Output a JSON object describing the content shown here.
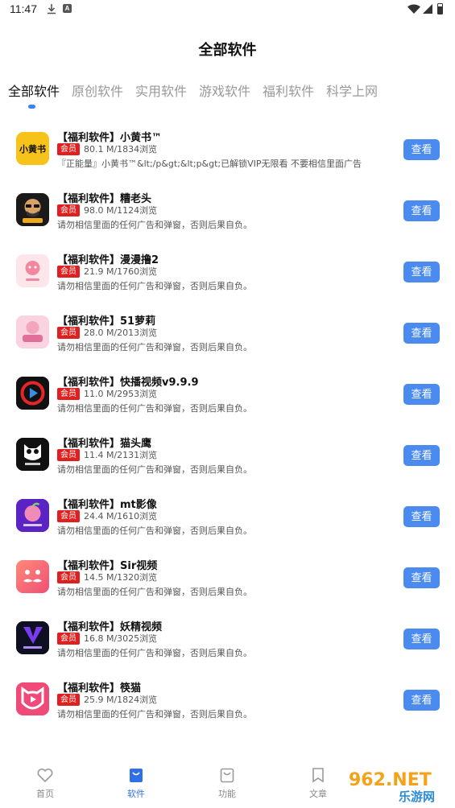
{
  "status_bar": {
    "time": "11:47",
    "a_label": "A"
  },
  "page": {
    "title": "全部软件"
  },
  "tabs": [
    {
      "label": "全部软件",
      "active": true
    },
    {
      "label": "原创软件",
      "active": false
    },
    {
      "label": "实用软件",
      "active": false
    },
    {
      "label": "游戏软件",
      "active": false
    },
    {
      "label": "福利软件",
      "active": false
    },
    {
      "label": "科学上网",
      "active": false
    }
  ],
  "items": [
    {
      "title": "【福利软件】小黄书™",
      "badge": "会员",
      "meta": "80.1 M/1834浏览",
      "desc": "『正能量』小黄书™&lt;/p&gt;&lt;p&gt;已解锁VIP无限看 不要相信里面广告",
      "icon_text": "小黄书",
      "icon_name": "xiaohuangshu-app-icon",
      "button": "查看"
    },
    {
      "title": "【福利软件】糟老头",
      "badge": "会员",
      "meta": "98.0 M/1124浏览",
      "desc": "请勿相信里面的任何广告和弹窗，否则后果自负。",
      "icon_text": "",
      "icon_name": "zaolaotou-app-icon",
      "button": "查看"
    },
    {
      "title": "【福利软件】漫漫撸2",
      "badge": "会员",
      "meta": "21.9 M/1760浏览",
      "desc": "请勿相信里面的任何广告和弹窗，否则后果自负。",
      "icon_text": "",
      "icon_name": "manmanlu-app-icon",
      "button": "查看"
    },
    {
      "title": "【福利软件】51萝莉",
      "badge": "会员",
      "meta": "28.0 M/2013浏览",
      "desc": "请勿相信里面的任何广告和弹窗，否则后果自负。",
      "icon_text": "",
      "icon_name": "51luoli-app-icon",
      "button": "查看"
    },
    {
      "title": "【福利软件】快播视频v9.9.9",
      "badge": "会员",
      "meta": "11.0 M/2953浏览",
      "desc": "请勿相信里面的任何广告和弹窗，否则后果自负。",
      "icon_text": "",
      "icon_name": "kuaibo-app-icon",
      "button": "查看"
    },
    {
      "title": "【福利软件】猫头鹰",
      "badge": "会员",
      "meta": "11.4 M/2131浏览",
      "desc": "请勿相信里面的任何广告和弹窗，否则后果自负。",
      "icon_text": "",
      "icon_name": "maotouying-app-icon",
      "button": "查看"
    },
    {
      "title": "【福利软件】mt影像",
      "badge": "会员",
      "meta": "24.4 M/1610浏览",
      "desc": "请勿相信里面的任何广告和弹窗，否则后果自负。",
      "icon_text": "",
      "icon_name": "mt-app-icon",
      "button": "查看"
    },
    {
      "title": "【福利软件】Sir视频",
      "badge": "会员",
      "meta": "14.5 M/1320浏览",
      "desc": "请勿相信里面的任何广告和弹窗，否则后果自负。",
      "icon_text": "",
      "icon_name": "sir-app-icon",
      "button": "查看"
    },
    {
      "title": "【福利软件】妖精视频",
      "badge": "会员",
      "meta": "16.8 M/3025浏览",
      "desc": "请勿相信里面的任何广告和弹窗，否则后果自负。",
      "icon_text": "",
      "icon_name": "yaojing-app-icon",
      "button": "查看"
    },
    {
      "title": "【福利软件】筷猫",
      "badge": "会员",
      "meta": "25.9 M/1824浏览",
      "desc": "请勿相信里面的任何广告和弹窗，否则后果自负。",
      "icon_text": "",
      "icon_name": "kuaimao-app-icon",
      "button": "查看"
    }
  ],
  "bottom_nav": [
    {
      "label": "首页",
      "active": false
    },
    {
      "label": "软件",
      "active": true
    },
    {
      "label": "功能",
      "active": false
    },
    {
      "label": "文章",
      "active": false
    }
  ],
  "watermark": {
    "top": "962.NET",
    "bottom": "乐游网"
  },
  "colors": {
    "accent": "#4b8bf0",
    "badge": "#e02020",
    "active_nav": "#2f6fe8"
  }
}
